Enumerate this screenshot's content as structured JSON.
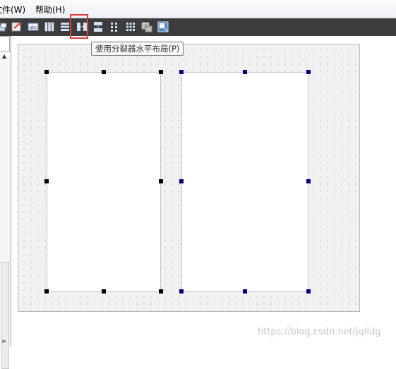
{
  "menubar": {
    "items": [
      "文件(W)",
      "帮助(H)"
    ]
  },
  "toolbar": {
    "buttons": [
      {
        "icon": "edit-widgets-icon"
      },
      {
        "icon": "edit-signals-slots-icon"
      },
      {
        "icon": "edit-buddies-icon"
      },
      {
        "icon": "layout-horizontal-icon"
      },
      {
        "icon": "layout-vertical-icon"
      },
      {
        "icon": "layout-horizontal-splitter-icon"
      },
      {
        "icon": "layout-vertical-splitter-icon"
      },
      {
        "icon": "layout-form-icon"
      },
      {
        "icon": "layout-grid-icon"
      },
      {
        "icon": "break-layout-icon"
      },
      {
        "icon": "adjust-size-icon"
      }
    ],
    "highlight_color": "#e23b3b"
  },
  "tooltip": {
    "text": "使用分裂器水平布局(P)"
  },
  "canvas": {
    "handle_colors": {
      "selected_primary": "#000000",
      "selected_secondary": "#000080"
    }
  },
  "watermark": {
    "text": "https://blog.csdn.net/jqlldg"
  }
}
